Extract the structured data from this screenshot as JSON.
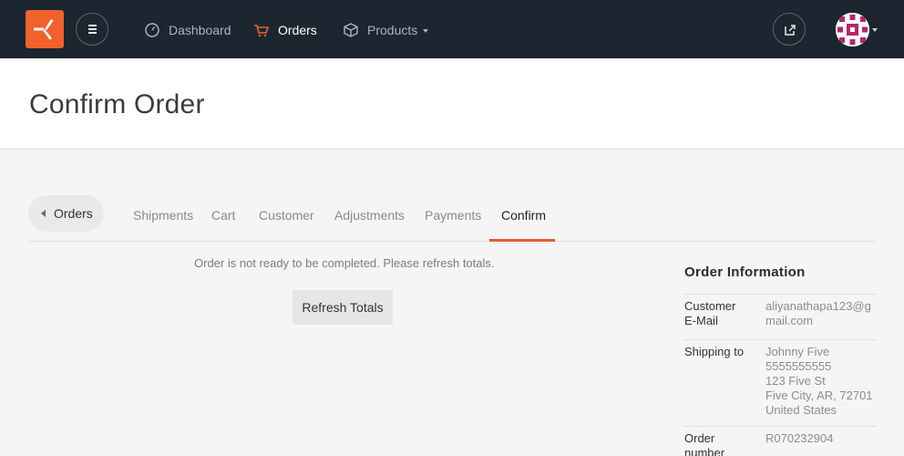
{
  "nav": {
    "items": [
      {
        "label": "Dashboard",
        "icon": "dashboard-icon"
      },
      {
        "label": "Orders",
        "icon": "cart-icon"
      },
      {
        "label": "Products",
        "icon": "box-icon"
      }
    ],
    "brand_color": "#f0612c",
    "bar_color": "#1c2631"
  },
  "page": {
    "title": "Confirm Order"
  },
  "tabs": {
    "back_label": "Orders",
    "items": [
      "Shipments",
      "Cart",
      "Customer",
      "Adjustments",
      "Payments",
      "Confirm"
    ],
    "active": "Confirm"
  },
  "main": {
    "notice": "Order is not ready to be completed. Please refresh totals.",
    "refresh_button": "Refresh Totals"
  },
  "order_info": {
    "title": "Order Information",
    "customer_email_label_1": "Customer",
    "customer_email_label_2": "E-Mail",
    "customer_email_1": "aliyanathapa123@g",
    "customer_email_2": "mail.com",
    "shipping_label": "Shipping to",
    "shipping_name": "Johnny Five",
    "shipping_phone": "5555555555",
    "shipping_street": "123 Five St",
    "shipping_city": "Five City, AR, 72701",
    "shipping_country": "United States",
    "order_number_label_1": "Order",
    "order_number_label_2": "number",
    "order_number": "R070232904"
  }
}
